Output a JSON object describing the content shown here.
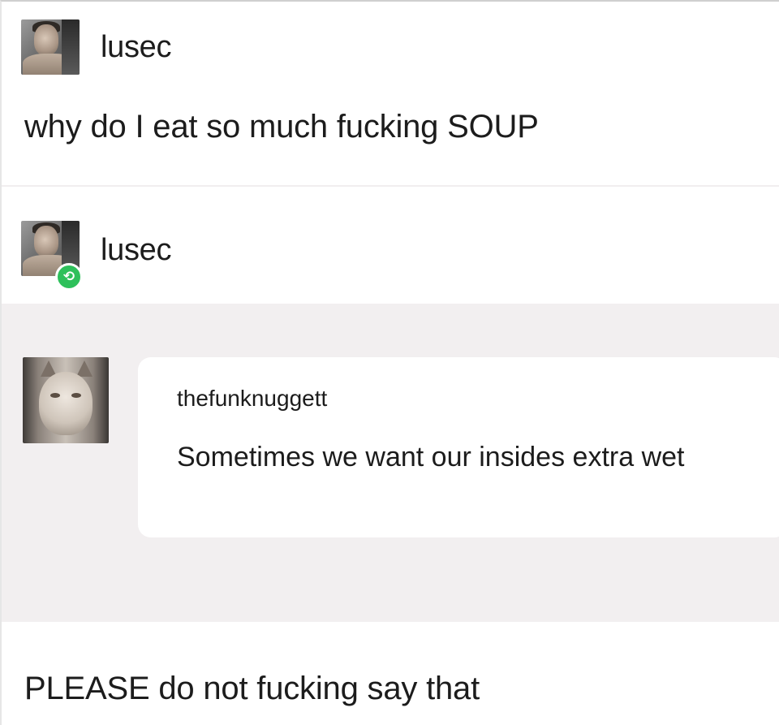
{
  "posts": [
    {
      "username": "lusec",
      "avatar_icon": "man-portrait-avatar",
      "text": "why do I eat so much fucking SOUP"
    },
    {
      "username": "lusec",
      "avatar_icon": "man-portrait-avatar",
      "badge_icon": "reblog-icon",
      "badge_glyph": "⟲",
      "badge_color": "#2ec05b",
      "quote": {
        "avatar_icon": "cat-avatar",
        "username": "thefunknuggett",
        "text": "Sometimes we want our insides extra wet"
      },
      "text": "PLEASE do not fucking say that"
    }
  ],
  "colors": {
    "band_background": "#f2eff0",
    "card_background": "#ffffff",
    "text": "#1c1c1c"
  }
}
